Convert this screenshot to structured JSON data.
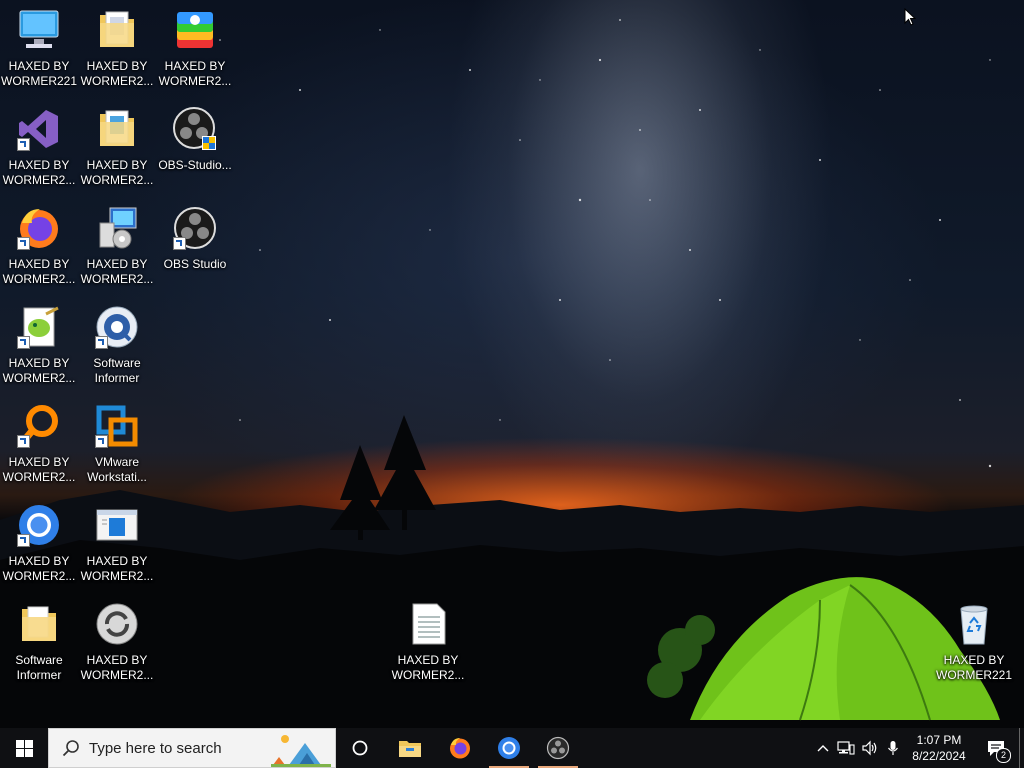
{
  "desktop_icons": [
    {
      "id": "computer",
      "label": "HAXED BY\nWORMER221",
      "icon": "this-pc-icon",
      "shortcut": false
    },
    {
      "id": "folder1",
      "label": "HAXED BY\nWORMER2...",
      "icon": "folder-icon",
      "shortcut": false
    },
    {
      "id": "bluestacks",
      "label": "HAXED BY\nWORMER2...",
      "icon": "bluestacks-icon",
      "shortcut": false
    },
    {
      "id": "vs",
      "label": "HAXED BY\nWORMER2...",
      "icon": "visual-studio-icon",
      "shortcut": true
    },
    {
      "id": "folder2",
      "label": "HAXED BY\nWORMER2...",
      "icon": "folder-icon",
      "shortcut": false
    },
    {
      "id": "obs_setup",
      "label": "OBS-Studio...",
      "icon": "obs-installer-icon",
      "shortcut": false
    },
    {
      "id": "firefox",
      "label": "HAXED BY\nWORMER2...",
      "icon": "firefox-icon",
      "shortcut": true
    },
    {
      "id": "installer",
      "label": "HAXED BY\nWORMER2...",
      "icon": "setup-icon",
      "shortcut": false
    },
    {
      "id": "obs",
      "label": "OBS Studio",
      "icon": "obs-icon",
      "shortcut": true
    },
    {
      "id": "notepadpp",
      "label": "HAXED BY\nWORMER2...",
      "icon": "notepad-plus-plus-icon",
      "shortcut": true
    },
    {
      "id": "si1",
      "label": "Software\nInformer",
      "icon": "software-informer-icon",
      "shortcut": true
    },
    {
      "id": "search_app",
      "label": "HAXED BY\nWORMER2...",
      "icon": "orange-search-icon",
      "shortcut": true
    },
    {
      "id": "vmware",
      "label": "VMware\nWorkstati...",
      "icon": "vmware-icon",
      "shortcut": true
    },
    {
      "id": "chrome",
      "label": "HAXED BY\nWORMER2...",
      "icon": "chromium-icon",
      "shortcut": true
    },
    {
      "id": "window_app",
      "label": "HAXED BY\nWORMER2...",
      "icon": "window-app-icon",
      "shortcut": false
    },
    {
      "id": "si2",
      "label": "Software\nInformer",
      "icon": "folder-icon",
      "shortcut": false
    },
    {
      "id": "ccleaner",
      "label": "HAXED BY\nWORMER2...",
      "icon": "refresh-app-icon",
      "shortcut": false
    },
    {
      "id": "textfile",
      "label": "HAXED BY\nWORMER2...",
      "icon": "text-file-icon",
      "shortcut": false
    },
    {
      "id": "recycle",
      "label": "HAXED BY\nWORMER221",
      "icon": "recycle-bin-icon",
      "shortcut": false
    }
  ],
  "taskbar": {
    "search_placeholder": "Type here to search",
    "pinned": [
      "file-explorer-icon",
      "firefox-icon",
      "chromium-icon",
      "obs-icon"
    ],
    "clock_time": "1:07 PM",
    "clock_date": "8/22/2024",
    "notification_count": "2"
  },
  "colors": {
    "taskbar": "#0f1013",
    "search_bg": "#f3f3f3",
    "active_indicator": "#e8a87c"
  }
}
